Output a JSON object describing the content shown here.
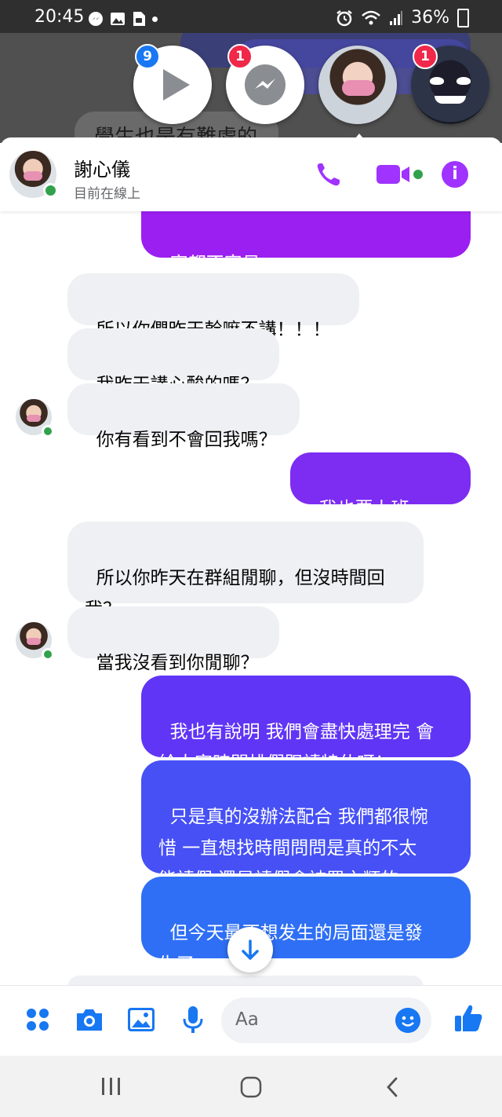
{
  "status_bar": {
    "time": "20:45",
    "battery": "36%",
    "icons": [
      "messenger-icon",
      "gallery-icon",
      "file-icon",
      "dot-icon",
      "alarm-icon",
      "wifi-icon",
      "signal-icon",
      "battery-icon"
    ]
  },
  "chat_heads": [
    {
      "kind": "video-player",
      "badge": "9",
      "badge_color": "#1877f2"
    },
    {
      "kind": "messenger",
      "badge": "1",
      "badge_color": "#f02849"
    },
    {
      "kind": "contact-photo",
      "badge": ""
    },
    {
      "kind": "contact-dark-avatar",
      "badge": "1",
      "badge_color": "#f02849"
    }
  ],
  "background_text": "學生也是有難處的",
  "header": {
    "name": "謝心儀",
    "status": "目前在線上",
    "actions": [
      "phone-icon",
      "video-call-icon",
      "info-icon"
    ]
  },
  "messages": [
    {
      "side": "out",
      "text": "家都不容易",
      "partial": true
    },
    {
      "side": "in",
      "text": "所以你們昨天幹嘛不講！！！"
    },
    {
      "side": "in",
      "text": "我昨天講心酸的嗎？"
    },
    {
      "side": "in",
      "text": "你有看到不會回我嗎？"
    },
    {
      "side": "out",
      "text": "我也要上班啊……"
    },
    {
      "side": "in",
      "text": "所以你昨天在群組閒聊，但沒時間回\n我？"
    },
    {
      "side": "in",
      "text": "當我沒看到你閒聊？"
    },
    {
      "side": "out",
      "text": "我也有說明 我們會盡快處理完 會\n給大家時間排假跟請特休呀！"
    },
    {
      "side": "out",
      "text": "只是真的沒辦法配合 我們都很惋\n惜 一直想找時間問問是真的不太\n能請假 還是請假會被罵之類的"
    },
    {
      "side": "out",
      "text": "但今天最不想发生的局面還是發\n生了"
    }
  ],
  "composer": {
    "placeholder": "Aa",
    "buttons": [
      "apps-icon",
      "camera-icon",
      "image-icon",
      "microphone-icon",
      "emoji-icon",
      "thumbs-up-icon"
    ]
  },
  "nav": [
    "recent-apps-icon",
    "home-icon",
    "back-icon"
  ],
  "colors": {
    "accent": "#a033ff",
    "out_top": "#9b1ff0",
    "out_mid": "#6b35f5",
    "out_bottom": "#2f6ff5",
    "online": "#31a24c",
    "icons_blue": "#1877f2"
  }
}
